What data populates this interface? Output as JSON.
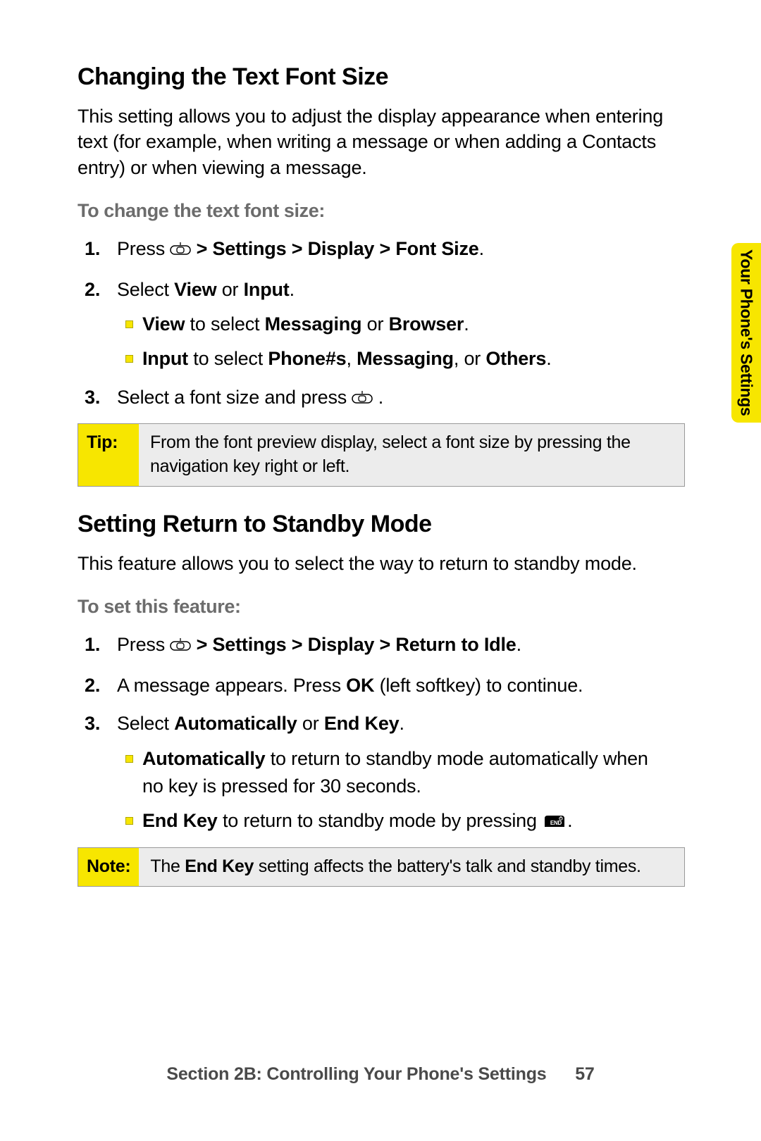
{
  "side_tab": "Your Phone's Settings",
  "section1": {
    "heading": "Changing the Text Font Size",
    "intro": "This setting allows you to adjust the display appearance when entering text (for example, when writing a message or when adding a Contacts entry) or when viewing a message.",
    "subhead": "To change the text font size:",
    "steps": {
      "s1a": "Press ",
      "s1b": " > Settings > Display > Font Size",
      "s1c": ".",
      "s2a": "Select ",
      "s2b": "View",
      "s2c": " or ",
      "s2d": "Input",
      "s2e": ".",
      "s2v1a": "View",
      "s2v1b": " to select ",
      "s2v1c": "Messaging",
      "s2v1d": " or ",
      "s2v1e": "Browser",
      "s2v1f": ".",
      "s2v2a": "Input",
      "s2v2b": " to select ",
      "s2v2c": "Phone#s",
      "s2v2d": ", ",
      "s2v2e": "Messaging",
      "s2v2f": ", or ",
      "s2v2g": "Others",
      "s2v2h": ".",
      "s3a": "Select a font size and press ",
      "s3b": " ."
    },
    "tip_label": "Tip:",
    "tip_body": "From the font preview display, select a font size by pressing the navigation key right or left."
  },
  "section2": {
    "heading": "Setting Return to Standby Mode",
    "intro": "This feature allows you to select the way to return to standby mode.",
    "subhead": "To set this feature:",
    "steps": {
      "s1a": "Press ",
      "s1b": " > Settings > Display > Return to Idle",
      "s1c": ".",
      "s2a": "A message appears. Press ",
      "s2b": "OK",
      "s2c": " (left softkey) to continue.",
      "s3a": "Select ",
      "s3b": "Automatically",
      "s3c": " or ",
      "s3d": "End Key",
      "s3e": ".",
      "s3v1a": "Automatically",
      "s3v1b": " to return to standby mode automatically when no key is pressed for 30 seconds.",
      "s3v2a": "End Key",
      "s3v2b": " to return to standby mode by pressing ",
      "s3v2c": "."
    },
    "note_label": "Note:",
    "note_a": "The ",
    "note_b": "End Key",
    "note_c": " setting affects the battery's talk and standby times."
  },
  "footer": {
    "text": "Section 2B: Controlling Your Phone's Settings",
    "page": "57"
  }
}
